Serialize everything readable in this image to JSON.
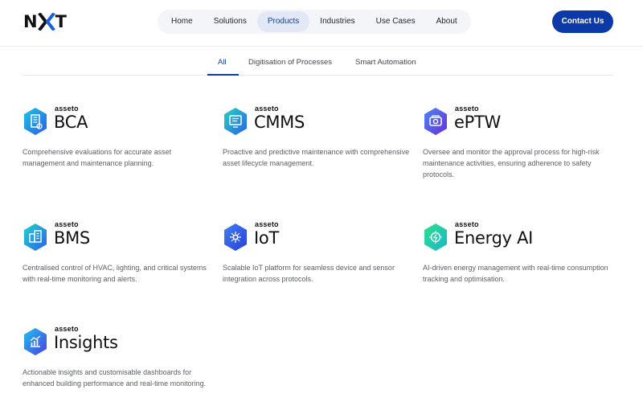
{
  "brand": {
    "logo_letters_left": "N",
    "logo_letters_right": "T"
  },
  "nav": {
    "items": [
      {
        "label": "Home"
      },
      {
        "label": "Solutions"
      },
      {
        "label": "Products"
      },
      {
        "label": "Industries"
      },
      {
        "label": "Use Cases"
      },
      {
        "label": "About"
      }
    ],
    "active": "Products",
    "cta_label": "Contact Us"
  },
  "tabs": {
    "items": [
      "All",
      "Digitisation of Processes",
      "Smart Automation"
    ],
    "active": "All"
  },
  "products": [
    {
      "prefix": "asseto",
      "name": "BCA",
      "icon": "building-report-icon",
      "description": "Comprehensive evaluations for accurate asset management and maintenance planning."
    },
    {
      "prefix": "asseto",
      "name": "CMMS",
      "icon": "clipboard-monitor-icon",
      "description": "Proactive and predictive maintenance with comprehensive asset lifecycle management."
    },
    {
      "prefix": "asseto",
      "name": "ePTW",
      "icon": "permit-gear-icon",
      "description": "Oversee and monitor the approval process for high-risk maintenance activities, ensuring adherence to safety protocols."
    },
    {
      "prefix": "asseto",
      "name": "BMS",
      "icon": "city-buildings-icon",
      "description": "Centralised control of HVAC, lighting, and critical systems with real-time monitoring and alerts."
    },
    {
      "prefix": "asseto",
      "name": "IoT",
      "icon": "network-hub-icon",
      "description": "Scalable IoT platform for seamless device and sensor integration across protocols."
    },
    {
      "prefix": "asseto",
      "name": "Energy AI",
      "icon": "energy-bolt-icon",
      "description": "AI-driven energy management with real-time consumption tracking and optimisation."
    },
    {
      "prefix": "asseto",
      "name": "Insights",
      "icon": "analytics-chart-icon",
      "description": "Actionable insights and customisable dashboards for enhanced building performance and real-time monitoring."
    }
  ],
  "colors": {
    "primary": "#0b3aa8",
    "nav_active_bg": "#e2e8f6",
    "hex_gradients": [
      [
        "#16c6e6",
        "#2f5ee8"
      ],
      [
        "#25d3c6",
        "#2a63e6"
      ],
      [
        "#4a86f2",
        "#6a2fe0"
      ],
      [
        "#1cd6d2",
        "#2d5fe6"
      ],
      [
        "#3f7ff1",
        "#2b3fd9"
      ],
      [
        "#2ee08a",
        "#16b7c9"
      ],
      [
        "#1fc3ee",
        "#4a3fe4"
      ]
    ]
  }
}
